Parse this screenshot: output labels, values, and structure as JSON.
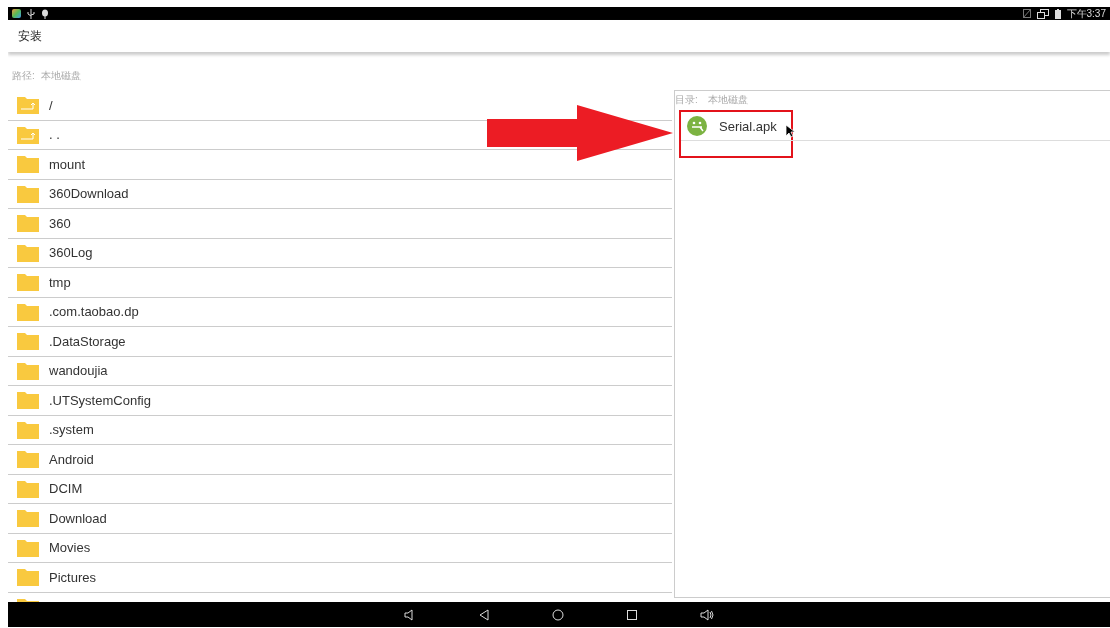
{
  "status_bar": {
    "time": "下午3:37"
  },
  "title": "安装",
  "path": {
    "label": "路径:",
    "value": "本地磁盘"
  },
  "folders": [
    {
      "kind": "up",
      "name": "/"
    },
    {
      "kind": "up",
      "name": ". ."
    },
    {
      "kind": "folder",
      "name": "mount"
    },
    {
      "kind": "folder",
      "name": "360Download"
    },
    {
      "kind": "folder",
      "name": "360"
    },
    {
      "kind": "folder",
      "name": "360Log"
    },
    {
      "kind": "folder",
      "name": "tmp"
    },
    {
      "kind": "folder",
      "name": ".com.taobao.dp"
    },
    {
      "kind": "folder",
      "name": ".DataStorage"
    },
    {
      "kind": "folder",
      "name": "wandoujia"
    },
    {
      "kind": "folder",
      "name": ".UTSystemConfig"
    },
    {
      "kind": "folder",
      "name": ".system"
    },
    {
      "kind": "folder",
      "name": "Android"
    },
    {
      "kind": "folder",
      "name": "DCIM"
    },
    {
      "kind": "folder",
      "name": "Download"
    },
    {
      "kind": "folder",
      "name": "Movies"
    },
    {
      "kind": "folder",
      "name": "Pictures"
    },
    {
      "kind": "folder"
    }
  ],
  "directory": {
    "label": "目录:",
    "value": "本地磁盘"
  },
  "files": [
    {
      "name": "Serial.apk",
      "highlighted": true
    }
  ]
}
